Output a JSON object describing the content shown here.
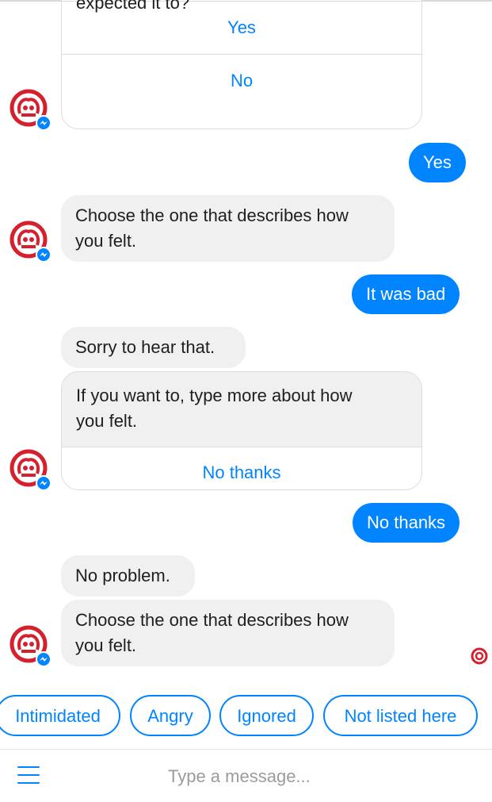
{
  "colors": {
    "accent": "#0084ff",
    "bot_bubble": "#f1f0f0",
    "brand_red": "#d5202e",
    "text": "#1c1e21",
    "placeholder": "#9b9b9b"
  },
  "icons": {
    "bot_avatar": "bot-logo-icon",
    "messenger_badge": "messenger-badge-icon",
    "menu": "hamburger-menu-icon",
    "seen": "seen-indicator-icon"
  },
  "conversation": {
    "partial_question": "expected it to?",
    "card1": {
      "buttons": [
        "Yes",
        "No"
      ]
    },
    "user_reply_1": "Yes",
    "bot_message_1": {
      "line1": "Choose the one that describes how",
      "line2": "you felt."
    },
    "user_reply_2": "It was bad",
    "bot_message_2": "Sorry to hear that.",
    "card2": {
      "line1": "If you want to, type more about how",
      "line2": "you felt.",
      "buttons": [
        "No thanks"
      ]
    },
    "user_reply_3": "No thanks",
    "bot_message_3": "No problem.",
    "bot_message_4": {
      "line1": "Choose the one that describes how",
      "line2": "you felt."
    }
  },
  "quick_replies": [
    "Intimidated",
    "Angry",
    "Ignored",
    "Not listed here"
  ],
  "composer": {
    "placeholder": "Type a message..."
  }
}
